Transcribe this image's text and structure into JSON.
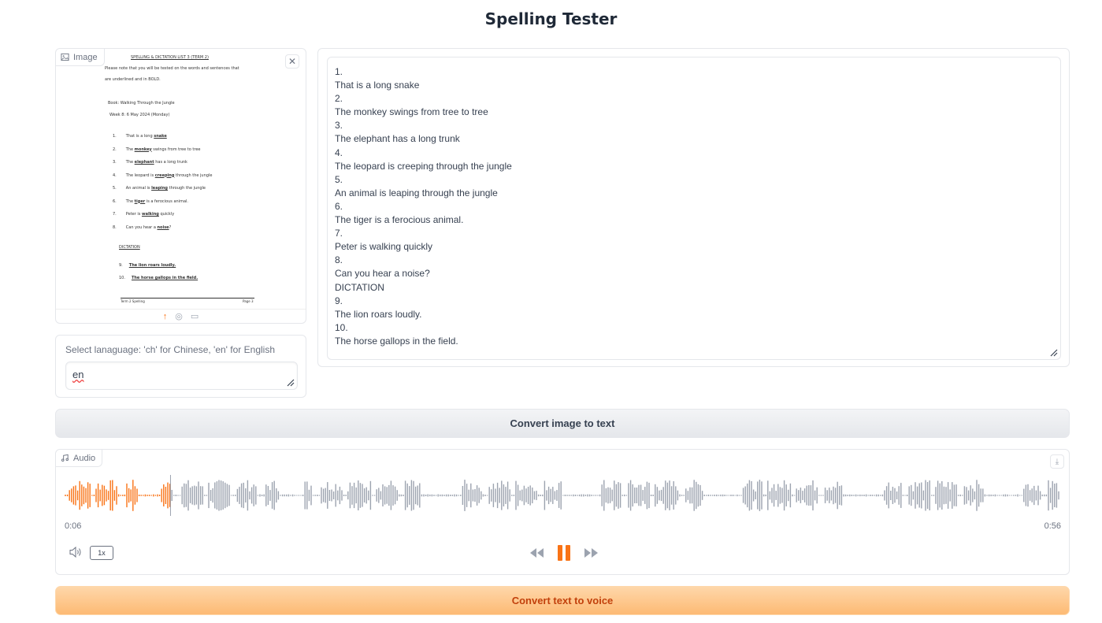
{
  "page": {
    "title": "Spelling Tester"
  },
  "image_block": {
    "label": "Image",
    "clear_icon": "close-icon",
    "toolbar_icons": [
      "upload-icon",
      "webcam-icon",
      "clipboard-icon"
    ],
    "document": {
      "heading": "SPELLING & DICTATION LIST 3 (TERM 2)",
      "intro_line1": "Please note that you will be tested on the words and sentences that",
      "intro_line2": "are underlined and in BOLD.",
      "book": "Book: Walking Through the Jungle",
      "week": "Week 8: 6 May 2024 (Monday)",
      "items": [
        {
          "num": "1.",
          "pre": "That is a long ",
          "word": "snake",
          "post": ""
        },
        {
          "num": "2.",
          "pre": "The ",
          "word": "monkey",
          "post": " swings from tree to tree"
        },
        {
          "num": "3.",
          "pre": "The ",
          "word": "elephant",
          "post": " has a long trunk"
        },
        {
          "num": "4.",
          "pre": "The leopard is ",
          "word": "creeping",
          "post": " through the jungle"
        },
        {
          "num": "5.",
          "pre": "An animal is ",
          "word": "leaping",
          "post": " through the jungle"
        },
        {
          "num": "6.",
          "pre": "The ",
          "word": "tiger",
          "post": " is a ferocious animal."
        },
        {
          "num": "7.",
          "pre": "Peter is ",
          "word": "walking",
          "post": " quickly"
        },
        {
          "num": "8.",
          "pre": "Can you hear a ",
          "word": "noise",
          "post": "?"
        }
      ],
      "dictation_heading": "DICTATION",
      "dictation_items": [
        {
          "num": "9.",
          "text": "The lion roars loudly."
        },
        {
          "num": "10.",
          "text": "The horse gallops in the field."
        }
      ],
      "footer_left": "Term 2 Spelling",
      "footer_right": "Page 3"
    }
  },
  "language_block": {
    "label": "Select lanaguage: 'ch' for Chinese, 'en' for English",
    "value": "en"
  },
  "output_text": {
    "lines": [
      "1.",
      "That is a long snake",
      "2.",
      "The monkey swings from tree to tree",
      "3.",
      "The elephant has a long trunk",
      "4.",
      "The leopard is creeping through the jungle",
      "5.",
      "An animal is leaping through the jungle",
      "6.",
      "The tiger is a ferocious animal.",
      "7.",
      "Peter is walking quickly",
      "8.",
      "Can you hear a noise?",
      "DICTATION",
      "9.",
      "The lion roars loudly.",
      "10.",
      "The horse gallops in the field."
    ]
  },
  "buttons": {
    "convert_image": "Convert image to text",
    "convert_voice": "Convert text to voice"
  },
  "audio_block": {
    "label": "Audio",
    "current_time": "0:06",
    "duration": "0:56",
    "progress": 0.107,
    "playback_rate": "1x",
    "state": "playing",
    "played_color": "#f97316",
    "unplayed_color": "#9ca3af",
    "icons": [
      "music-icon",
      "download-icon",
      "volume-icon",
      "rewind-icon",
      "pause-icon",
      "fast-forward-icon"
    ]
  }
}
